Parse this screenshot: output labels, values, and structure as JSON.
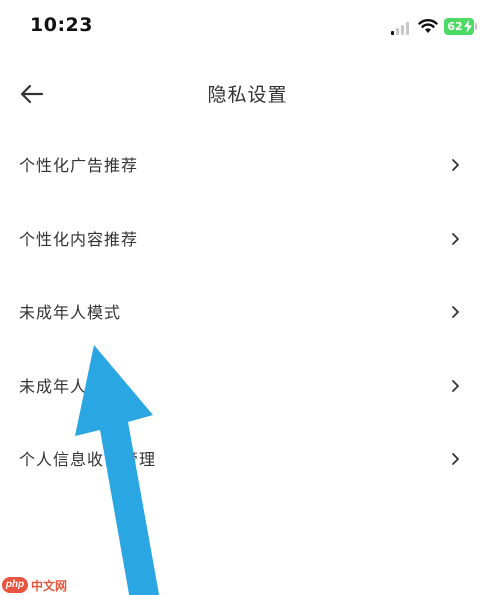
{
  "status_bar": {
    "time": "10:23",
    "battery_level": "62",
    "battery_color": "#4cd964",
    "icons": [
      "signal-icon",
      "wifi-icon",
      "battery-icon",
      "bolt-icon"
    ]
  },
  "header": {
    "back_icon": "arrow-left-icon",
    "title": "隐私设置"
  },
  "settings": {
    "items": [
      {
        "label": "个性化广告推荐",
        "icon": "chevron-right-icon"
      },
      {
        "label": "个性化内容推荐",
        "icon": "chevron-right-icon"
      },
      {
        "label": "未成年人模式",
        "icon": "chevron-right-icon"
      },
      {
        "label": "未成年人",
        "icon": "chevron-right-icon"
      },
      {
        "label": "个人信息收",
        "label_tail": "管理",
        "icon": "chevron-right-icon"
      }
    ]
  },
  "overlay": {
    "arrow_color": "#2aa7e2",
    "icon": "pointer-arrow-icon"
  },
  "watermark": {
    "logo": "php",
    "text": "中文网",
    "color": "#e8553e"
  }
}
